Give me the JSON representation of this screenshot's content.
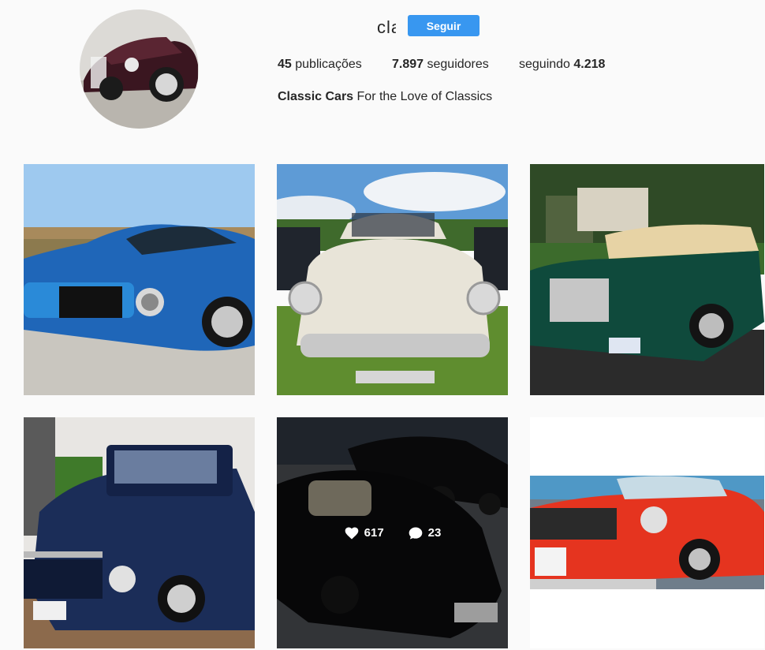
{
  "profile": {
    "username": "classiccars",
    "follow_label": "Seguir",
    "stats": {
      "posts_count": "45",
      "posts_label": "publicações",
      "followers_count": "7.897",
      "followers_label": "seguidores",
      "following_label": "seguindo",
      "following_count": "4.218"
    },
    "bio": {
      "full_name": "Classic Cars",
      "text": "For the Love of Classics"
    }
  },
  "posts": [
    {
      "subject": "blue muscle car"
    },
    {
      "subject": "white vintage sedan"
    },
    {
      "subject": "green luxury coupe"
    },
    {
      "subject": "navy blue pickup"
    },
    {
      "subject": "black roadsters",
      "likes": "617",
      "comments": "23"
    },
    {
      "subject": "red mustang"
    }
  ],
  "colors": {
    "accent": "#3897f0",
    "text": "#262626",
    "background": "#fafafa"
  }
}
